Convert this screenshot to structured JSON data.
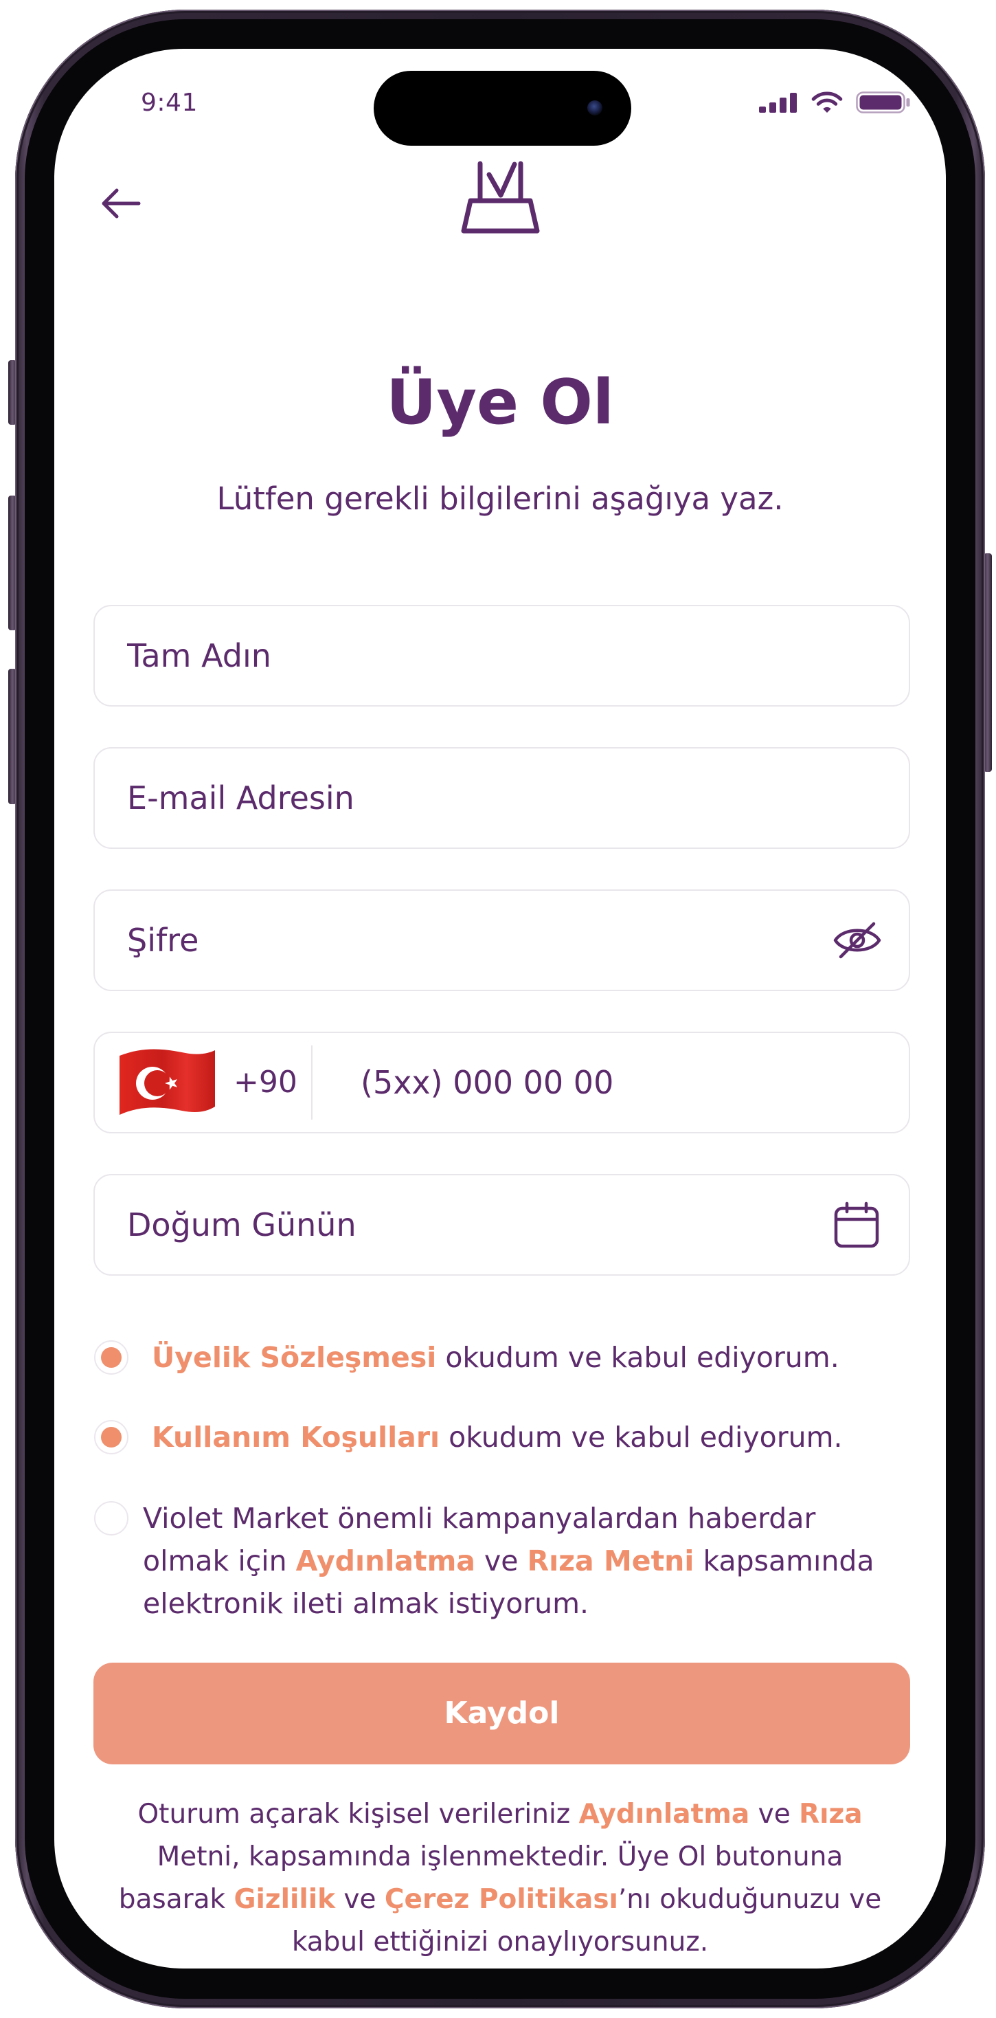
{
  "colors": {
    "primary": "#5c2b6c",
    "accent": "#ef8f6c",
    "button": "#ee977f",
    "border": "#e9e6eb"
  },
  "status_bar": {
    "time": "9:41",
    "icons": [
      "cellular-signal-icon",
      "wifi-icon",
      "battery-icon"
    ]
  },
  "header": {
    "back_icon": "arrow-left-icon",
    "logo_icon": "shopping-bag-logo-icon"
  },
  "title": "Üye Ol",
  "subtitle": "Lütfen gerekli bilgilerini aşağıya yaz.",
  "form": {
    "full_name": {
      "placeholder": "Tam Adın",
      "value": ""
    },
    "email": {
      "placeholder": "E-mail Adresin",
      "value": ""
    },
    "password": {
      "placeholder": "Şifre",
      "value": "",
      "toggle_icon": "eye-off-icon"
    },
    "phone": {
      "flag_icon": "turkey-flag-icon",
      "dial_code": "+90",
      "placeholder": "(5xx) 000 00 00",
      "value": ""
    },
    "birth_date": {
      "placeholder": "Doğum Günün",
      "value": "",
      "icon": "calendar-icon"
    }
  },
  "consents": [
    {
      "checked": true,
      "segments": [
        "Üyelik Sözleşmesi",
        " okudum ve kabul ediyorum."
      ]
    },
    {
      "checked": true,
      "segments": [
        "Kullanım Koşulları",
        " okudum ve kabul ediyorum."
      ]
    },
    {
      "checked": false,
      "segments": [
        "Violet Market önemli kampanyalardan haberdar olmak için ",
        "Aydınlatma",
        " ve ",
        "Rıza Metni",
        " kapsamında elektronik ileti almak istiyorum."
      ]
    }
  ],
  "submit_label": "Kaydol",
  "footer": {
    "segments": [
      "Oturum açarak kişisel verileriniz ",
      "Aydınlatma",
      " ve ",
      "Rıza",
      " Metni, kapsamında işlenmektedir. Üye Ol butonuna basarak ",
      "Gizlilik",
      " ve ",
      "Çerez Politikası",
      "’nı okuduğunuzu ve kabul ettiğinizi onaylıyorsunuz."
    ]
  }
}
